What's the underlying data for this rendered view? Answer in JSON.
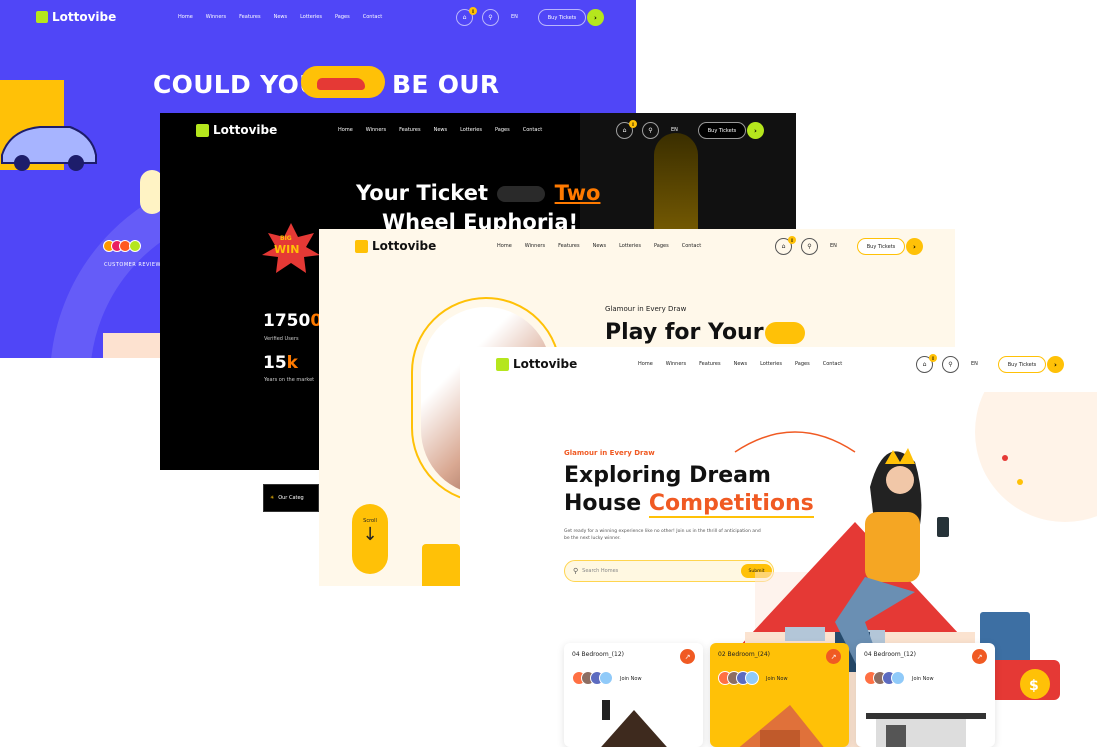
{
  "brand": "Lottovibe",
  "nav": [
    "Home",
    "Winners",
    "Features",
    "News",
    "Lotteries",
    "Pages",
    "Contact"
  ],
  "lang": "EN",
  "cart_count": "0",
  "buy_tickets": "Buy Tickets",
  "card1": {
    "headline": "COULD YOU",
    "headline_end": "BE OUR",
    "reviews_label": "CUSTOMER REVIEWS"
  },
  "card2": {
    "headline_a": "Your Ticket",
    "headline_b": "Two",
    "headline_c": "Wheel Euphoria!",
    "badge_top": "BIG",
    "badge_main": "WIN",
    "stat1_value": "1750",
    "stat1_suffix": "0+",
    "stat1_label": "Verified Users",
    "stat2_value": "15",
    "stat2_suffix": "k",
    "stat2_label": "Years on the market",
    "bottom_button": "Our Categ"
  },
  "card3": {
    "eyebrow": "Glamour in Every Draw",
    "headline": "Play for Your",
    "scroll": "Scroll"
  },
  "card4": {
    "eyebrow": "Glamour in Every Draw",
    "headline_a": "Exploring Dream",
    "headline_b": "House",
    "headline_c": "Competitions",
    "description": "Get ready for a winning experience like no other! Join us in the thrill of anticipation and be the next lucky winner.",
    "search_placeholder": "Search Homes",
    "submit": "Submit",
    "houses": [
      {
        "title": "04 Bedroom_(12)",
        "join": "Join Now"
      },
      {
        "title": "02 Bedroom_(24)",
        "join": "Join Now"
      },
      {
        "title": "04 Bedroom_(12)",
        "join": "Join Now"
      }
    ]
  },
  "colors": {
    "accent_yellow": "#ffc107",
    "accent_orange": "#f05a23",
    "brand_lime": "#b5e61d",
    "purple": "#5046f7"
  }
}
